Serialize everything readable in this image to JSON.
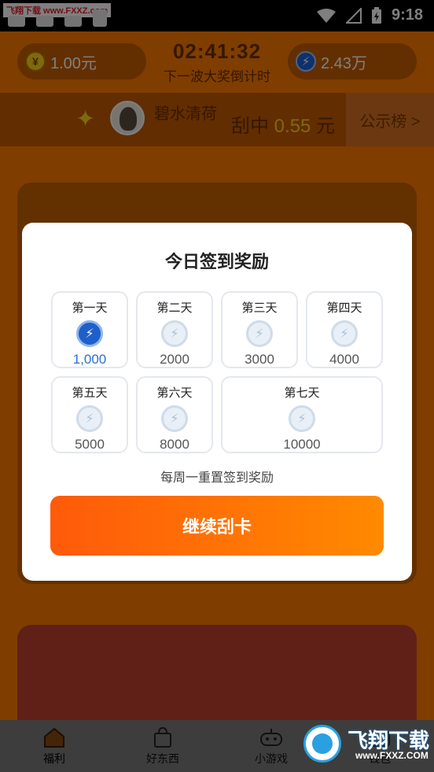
{
  "status_bar": {
    "time": "9:18",
    "watermark": "飞翔下载 www.FXXZ.com"
  },
  "header": {
    "balance_yuan": "1.00元",
    "coins": "2.43万",
    "countdown": "02:41:32",
    "countdown_label": "下一波大奖倒计时"
  },
  "winner": {
    "name": "碧水清荷",
    "prefix": "刮中 ",
    "amount": "0.55",
    "suffix": " 元",
    "rank_button": "公示榜 >"
  },
  "dialog": {
    "title": "今日签到奖励",
    "days": [
      {
        "label": "第一天",
        "value": "1,000",
        "active": true
      },
      {
        "label": "第二天",
        "value": "2000",
        "active": false
      },
      {
        "label": "第三天",
        "value": "3000",
        "active": false
      },
      {
        "label": "第四天",
        "value": "4000",
        "active": false
      },
      {
        "label": "第五天",
        "value": "5000",
        "active": false
      },
      {
        "label": "第六天",
        "value": "8000",
        "active": false
      },
      {
        "label": "第七天",
        "value": "10000",
        "active": false
      }
    ],
    "note": "每周一重置签到奖励",
    "continue_button": "继续刮卡"
  },
  "tabs": [
    {
      "label": "福利",
      "icon": "home-icon"
    },
    {
      "label": "好东西",
      "icon": "shopping-bag-icon"
    },
    {
      "label": "小游戏",
      "icon": "gamepad-icon"
    },
    {
      "label": "钱包",
      "icon": "wallet-icon"
    }
  ],
  "logo_watermark": {
    "title": "飞翔下载",
    "url": "www.FXXZ.COM"
  }
}
